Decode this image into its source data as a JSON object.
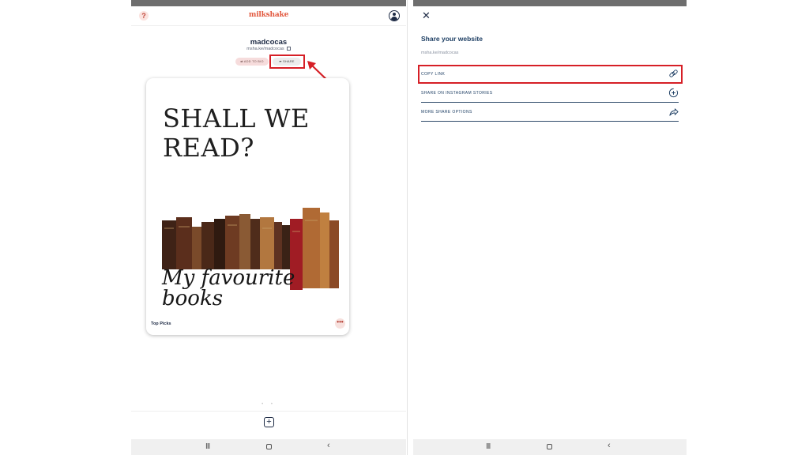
{
  "left": {
    "brand": "milkshake",
    "profile": {
      "username": "madcocas",
      "url": "msha.ke/madcocas"
    },
    "buttons": {
      "add_to_bio": "ADD TO BIO",
      "share": "SHARE"
    },
    "card": {
      "heading_line1": "SHALL WE",
      "heading_line2": "READ?",
      "script_line1": "My favourite",
      "script_line2": "books",
      "label": "Top Picks",
      "more": "•••"
    },
    "dots": "• •",
    "add_button": "+"
  },
  "right": {
    "close": "✕",
    "title": "Share your website",
    "url": "msha.ke/madcocas",
    "options": [
      {
        "label": "COPY LINK",
        "icon": "link-icon"
      },
      {
        "label": "SHARE ON INSTAGRAM STORIES",
        "icon": "instagram-add-icon"
      },
      {
        "label": "MORE SHARE OPTIONS",
        "icon": "share-arrow-icon"
      }
    ]
  },
  "nav": {
    "recents": "III",
    "back": "‹"
  },
  "colors": {
    "brand": "#e2583e",
    "navy": "#1d3e63",
    "highlight": "#d61f26",
    "pill_pink": "#f6dcdc"
  }
}
